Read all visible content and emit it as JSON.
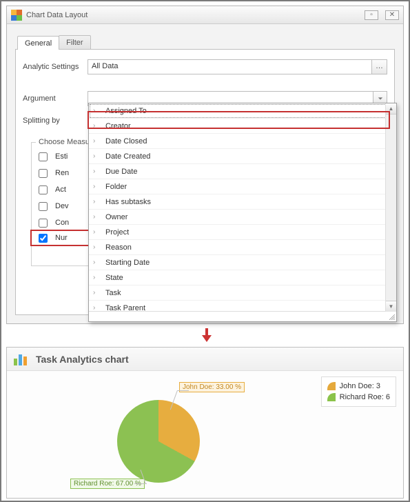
{
  "dialog": {
    "title": "Chart Data Layout",
    "tabs": {
      "general": "General",
      "filter": "Filter"
    },
    "analytic_label": "Analytic Settings",
    "analytic_value": "All Data",
    "argument_label": "Argument",
    "argument_value": "",
    "splitting_label": "Splitting by",
    "splitting_value": "Assigned To",
    "measures_title": "Choose Measur",
    "measures": [
      {
        "label": "Esti",
        "checked": false
      },
      {
        "label": "Ren",
        "checked": false
      },
      {
        "label": "Act",
        "checked": false
      },
      {
        "label": "Dev",
        "checked": false
      },
      {
        "label": "Con",
        "checked": false
      },
      {
        "label": "Nur",
        "checked": true
      }
    ],
    "dropdown": {
      "items": [
        "Assigned To",
        "Creator",
        "Date Closed",
        "Date Created",
        "Due Date",
        "Folder",
        "Has subtasks",
        "Owner",
        "Project",
        "Reason",
        "Starting Date",
        "State",
        "Task",
        "Task Parent"
      ],
      "selected": "Assigned To"
    }
  },
  "chart": {
    "title": "Task Analytics chart",
    "legend": {
      "john": "John Doe: 3",
      "richard": "Richard Roe: 6"
    },
    "callouts": {
      "john": "John Doe: 33.00 %",
      "richard": "Richard Roe: 67.00 %"
    }
  },
  "chart_data": {
    "type": "pie",
    "title": "Task Analytics chart",
    "series": [
      {
        "name": "John Doe",
        "value": 3,
        "percent": 33.0,
        "color": "#e7ad3f"
      },
      {
        "name": "Richard Roe",
        "value": 6,
        "percent": 67.0,
        "color": "#8cc152"
      }
    ]
  }
}
